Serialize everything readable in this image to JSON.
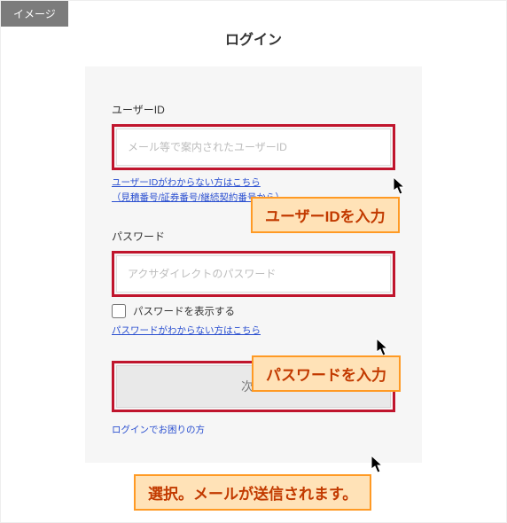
{
  "badge": "イメージ",
  "page_title": "ログイン",
  "user_id": {
    "label": "ユーザーID",
    "placeholder": "メール等で案内されたユーザーID",
    "help": "ユーザーIDがわからない方はこちら\n（見積番号/証券番号/継続契約番号から）"
  },
  "password": {
    "label": "パスワード",
    "placeholder": "アクサダイレクトのパスワード",
    "show_label": "パスワードを表示する",
    "help": "パスワードがわからない方はこちら"
  },
  "next_button": "次へ",
  "login_help": "ログインでお困りの方",
  "callouts": {
    "user_id": "ユーザーIDを入力",
    "password": "パスワードを入力",
    "submit": "選択。メールが送信されます。"
  },
  "colors": {
    "highlight_border": "#c0152d",
    "callout_bg": "#ffe2b7",
    "callout_border": "#ff9a24",
    "callout_text": "#c23a00",
    "link": "#2a4fd0"
  }
}
